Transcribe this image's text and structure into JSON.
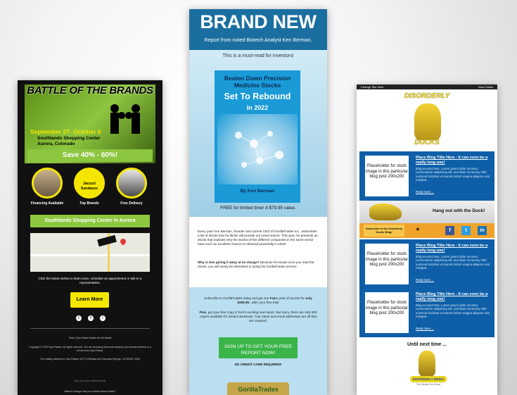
{
  "left": {
    "hero_title": "BATTLE OF THE BRANDS",
    "dates": "September 27- October 6",
    "venue_line1": "Southlands Shopping Center",
    "venue_line2": "Aurora, Colorado",
    "save_banner": "Save 40% - 60%!",
    "brand_logo": "Jacuzzi",
    "brand_name": "Sundance",
    "circle_labels": [
      "Financing Available",
      "Top Brands",
      "Free Delivery"
    ],
    "center_banner": "Southlands Shopping Center in Aurora",
    "cta_text": "Click the button below to learn more, schedule an appointment or talk to a representative.",
    "learn_more": "Learn More",
    "social": [
      "t",
      "f",
      "i"
    ],
    "small1": "*Ask a Spa Palace dealer for full details",
    "small2": "Copyright © 2016 Spa Palace, All rights reserved. You are receiving this email because you showed interest in a hot tub from Spa Palace.",
    "small3": "Our mailing address is: Spa Palace 4271 N Nevada Ave Colorado Springs, CO 80907-4336",
    "small4": "Add us to your address book",
    "small5": "Want to change how you receive these emails?"
  },
  "center": {
    "brand_new": "BRAND NEW",
    "report_line": "Report from noted Biotech Analyst Ken Berman.",
    "must_read": "This is a must-read for investors!",
    "book_title1": "Beaten Down Precision Medicine Stocks",
    "book_title2": "Set To Rebound",
    "book_title3": "In 2022",
    "book_author": "By Ken Berman",
    "free_line": "FREE for limited time! A $79.95 value.",
    "para1": "Every year Ken Berman, founder and current CEO of GorillaTrades Inc., assembles a list of stocks that he thinks will provide out sized returns. This year, he presents an ebook that explains why the stocks of five different companies in the same sector have such an excellent chance to rebound powerfully in 2022!",
    "para2_bold": "Why is Ken giving it away at no charge?",
    "para2_rest": " Because he knows once you read the ebook, you will surely be interested in trying his GorillaTrades service.",
    "para3_a": "Subscribe to GorillaTrades today and get one ",
    "para3_bold1": "FULL",
    "para3_b": " year of access for ",
    "para3_bold2": "only $499.95",
    "para3_c": "...after your free trial!",
    "para4_bold": "Plus",
    "para4_rest": ", get your free copy of Ken's exciting new report. But hurry, there are only 500 copies available for instant download. Your name and email addresses are all that are required.",
    "signup_button": "SIGN UP TO GET YOUR FREE REPORT NOW!",
    "no_cc": "NO CREDIT CARD REQUIRED!",
    "footer_logo": "GorillaTrades"
  },
  "right": {
    "topbar_left": "Change Title Here",
    "topbar_right": "View Online",
    "logo_top": "DISORDERLY",
    "logo_bottom": "DUCKS",
    "post_title": "Place Blog Title Here - It can even be a really long one!",
    "post_text": "Blog excerpt here. Lorem ipsum dolor sit amet, consectetuer adipiscing elit, sed diam nonummy nibh euismod tincidunt ut laoreet dolore magna aliquam erat volutpat ...",
    "read_more": "Read more ...",
    "placeholder": "Placeholder for stock image in this particular blog post 200x200",
    "hang_out": "Hang out with the Duck!",
    "subscribe_label": "Subscribe to the Disorderly Ducks Blog!",
    "plus": "+",
    "social": [
      "f",
      "t",
      "in"
    ],
    "until_next": "Until next time ...",
    "footer_badge": "DISORDERLY MEDIA",
    "footer_tag": "The Media You Covet"
  }
}
